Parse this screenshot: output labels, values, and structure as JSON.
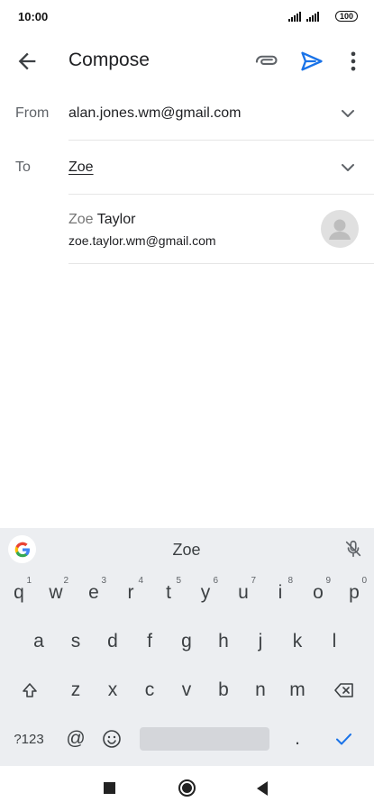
{
  "status_bar": {
    "time": "10:00",
    "battery": "100",
    "icons": [
      "signal-icon",
      "signal-icon",
      "battery-icon"
    ]
  },
  "app_bar": {
    "title": "Compose",
    "icons": [
      "back-arrow-icon",
      "paperclip-icon",
      "send-icon",
      "more-vert-icon"
    ],
    "accent_color": "#1a73e8"
  },
  "from": {
    "label": "From",
    "value": "alan.jones.wm@gmail.com"
  },
  "to": {
    "label": "To",
    "value": "Zoe"
  },
  "suggestion": {
    "name_match": "Zoe",
    "name_rest": " Taylor",
    "email": "zoe.taylor.wm@gmail.com",
    "icon": "person-icon"
  },
  "keyboard": {
    "suggestion": "Zoe",
    "row1": [
      {
        "key": "q",
        "sup": "1"
      },
      {
        "key": "w",
        "sup": "2"
      },
      {
        "key": "e",
        "sup": "3"
      },
      {
        "key": "r",
        "sup": "4"
      },
      {
        "key": "t",
        "sup": "5"
      },
      {
        "key": "y",
        "sup": "6"
      },
      {
        "key": "u",
        "sup": "7"
      },
      {
        "key": "i",
        "sup": "8"
      },
      {
        "key": "o",
        "sup": "9"
      },
      {
        "key": "p",
        "sup": "0"
      }
    ],
    "row2": [
      "a",
      "s",
      "d",
      "f",
      "g",
      "h",
      "j",
      "k",
      "l"
    ],
    "row3": [
      "z",
      "x",
      "c",
      "v",
      "b",
      "n",
      "m"
    ],
    "symbols_key": "?123",
    "at_key": "@",
    "period_key": ".",
    "icons": [
      "google-icon",
      "mic-off-icon",
      "shift-icon",
      "backspace-icon",
      "emoji-icon",
      "check-icon"
    ]
  },
  "nav_bar": {
    "icons": [
      "recents-icon",
      "home-icon",
      "back-icon"
    ]
  }
}
